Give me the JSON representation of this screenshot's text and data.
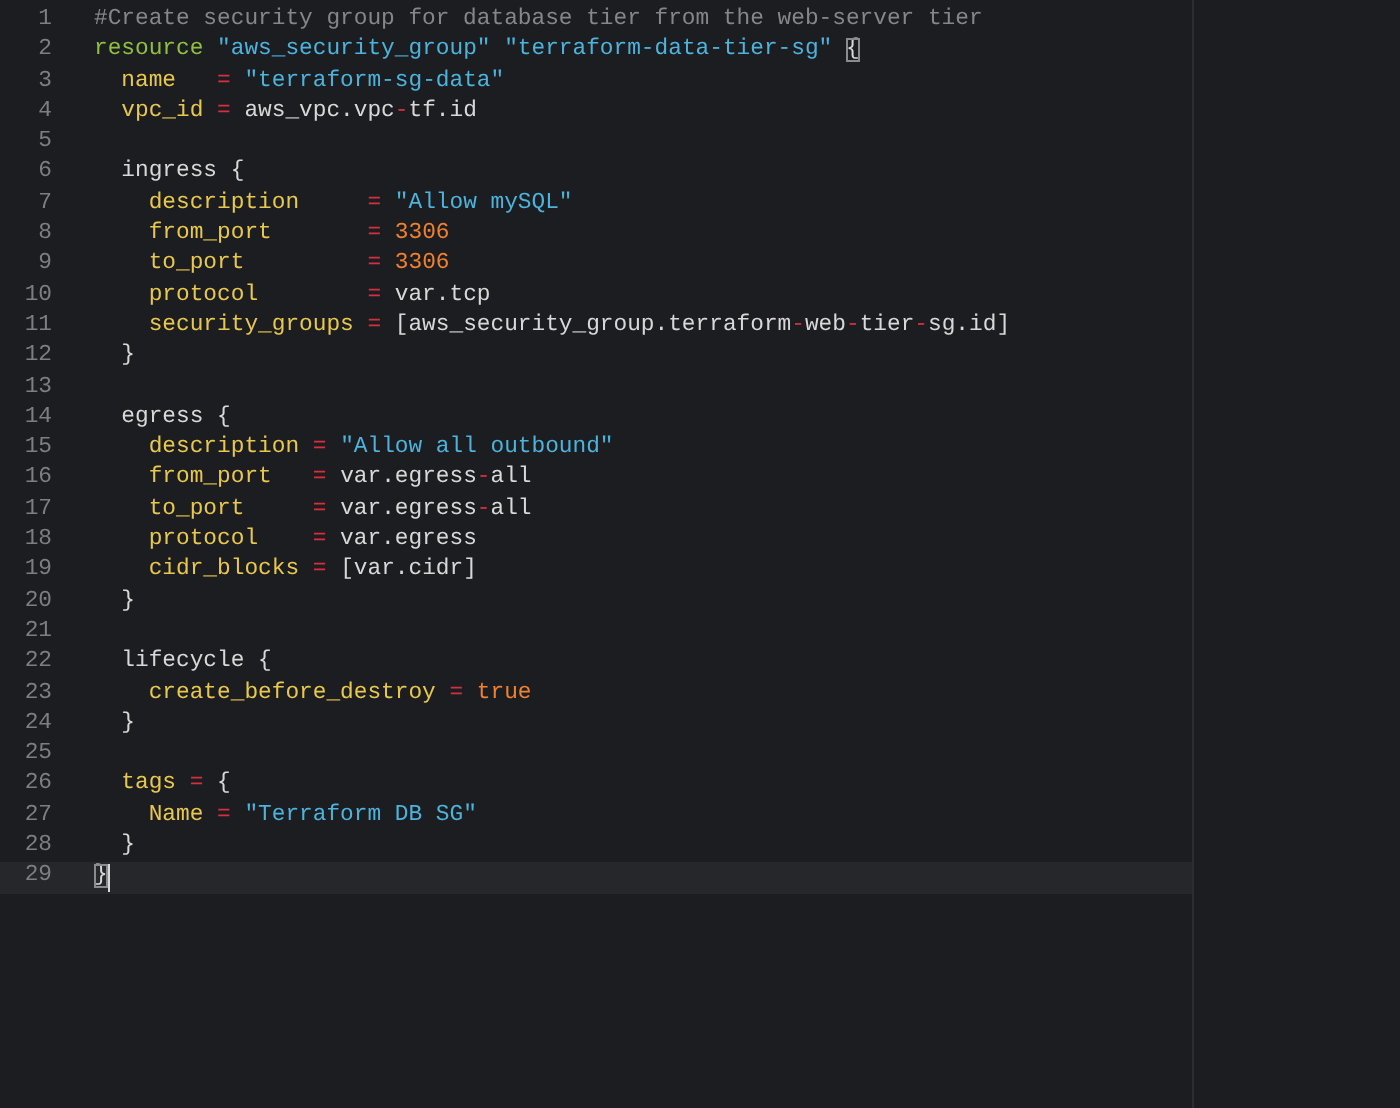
{
  "editor": {
    "lines": [
      {
        "number": "1",
        "current": false,
        "tokens": [
          {
            "kind": "comment",
            "text": "#Create security group for database tier from the web-server tier"
          }
        ]
      },
      {
        "number": "2",
        "current": false,
        "tokens": [
          {
            "kind": "keyword",
            "text": "resource "
          },
          {
            "kind": "string",
            "text": "\"aws_security_group\" "
          },
          {
            "kind": "string",
            "text": "\"terraform-data-tier-sg\" "
          },
          {
            "kind": "plain",
            "text": "{",
            "matched": true
          }
        ]
      },
      {
        "number": "3",
        "current": false,
        "tokens": [
          {
            "kind": "attribute",
            "text": "  name"
          },
          {
            "kind": "operator",
            "text": "   = "
          },
          {
            "kind": "string",
            "text": "\"terraform-sg-data\""
          }
        ]
      },
      {
        "number": "4",
        "current": false,
        "tokens": [
          {
            "kind": "attribute",
            "text": "  vpc_id"
          },
          {
            "kind": "operator",
            "text": " = "
          },
          {
            "kind": "plain",
            "text": "aws_vpc.vpc"
          },
          {
            "kind": "operator",
            "text": "-"
          },
          {
            "kind": "plain",
            "text": "tf.id"
          }
        ]
      },
      {
        "number": "5",
        "current": false
      },
      {
        "number": "6",
        "current": false,
        "tokens": [
          {
            "kind": "plain",
            "text": "  ingress {"
          }
        ]
      },
      {
        "number": "7",
        "current": false,
        "tokens": [
          {
            "kind": "attribute",
            "text": "    description"
          },
          {
            "kind": "operator",
            "text": "     = "
          },
          {
            "kind": "string",
            "text": "\"Allow mySQL\""
          }
        ]
      },
      {
        "number": "8",
        "current": false,
        "tokens": [
          {
            "kind": "attribute",
            "text": "    from_port"
          },
          {
            "kind": "operator",
            "text": "       = "
          },
          {
            "kind": "number",
            "text": "3306"
          }
        ]
      },
      {
        "number": "9",
        "current": false,
        "tokens": [
          {
            "kind": "attribute",
            "text": "    to_port"
          },
          {
            "kind": "operator",
            "text": "         = "
          },
          {
            "kind": "number",
            "text": "3306"
          }
        ]
      },
      {
        "number": "10",
        "current": false,
        "tokens": [
          {
            "kind": "attribute",
            "text": "    protocol"
          },
          {
            "kind": "operator",
            "text": "        = "
          },
          {
            "kind": "plain",
            "text": "var.tcp"
          }
        ]
      },
      {
        "number": "11",
        "current": false,
        "tokens": [
          {
            "kind": "attribute",
            "text": "    security_groups"
          },
          {
            "kind": "operator",
            "text": " = "
          },
          {
            "kind": "plain",
            "text": "[aws_security_group.terraform"
          },
          {
            "kind": "operator",
            "text": "-"
          },
          {
            "kind": "plain",
            "text": "web"
          },
          {
            "kind": "operator",
            "text": "-"
          },
          {
            "kind": "plain",
            "text": "tier"
          },
          {
            "kind": "operator",
            "text": "-"
          },
          {
            "kind": "plain",
            "text": "sg.id]"
          }
        ]
      },
      {
        "number": "12",
        "current": false,
        "tokens": [
          {
            "kind": "plain",
            "text": "  }"
          }
        ]
      },
      {
        "number": "13",
        "current": false
      },
      {
        "number": "14",
        "current": false,
        "tokens": [
          {
            "kind": "plain",
            "text": "  egress {"
          }
        ]
      },
      {
        "number": "15",
        "current": false,
        "tokens": [
          {
            "kind": "attribute",
            "text": "    description"
          },
          {
            "kind": "operator",
            "text": " = "
          },
          {
            "kind": "string",
            "text": "\"Allow all outbound\""
          }
        ]
      },
      {
        "number": "16",
        "current": false,
        "tokens": [
          {
            "kind": "attribute",
            "text": "    from_port"
          },
          {
            "kind": "operator",
            "text": "   = "
          },
          {
            "kind": "plain",
            "text": "var.egress"
          },
          {
            "kind": "operator",
            "text": "-"
          },
          {
            "kind": "plain",
            "text": "all"
          }
        ]
      },
      {
        "number": "17",
        "current": false,
        "tokens": [
          {
            "kind": "attribute",
            "text": "    to_port"
          },
          {
            "kind": "operator",
            "text": "     = "
          },
          {
            "kind": "plain",
            "text": "var.egress"
          },
          {
            "kind": "operator",
            "text": "-"
          },
          {
            "kind": "plain",
            "text": "all"
          }
        ]
      },
      {
        "number": "18",
        "current": false,
        "tokens": [
          {
            "kind": "attribute",
            "text": "    protocol"
          },
          {
            "kind": "operator",
            "text": "    = "
          },
          {
            "kind": "plain",
            "text": "var.egress"
          }
        ]
      },
      {
        "number": "19",
        "current": false,
        "tokens": [
          {
            "kind": "attribute",
            "text": "    cidr_blocks"
          },
          {
            "kind": "operator",
            "text": " = "
          },
          {
            "kind": "plain",
            "text": "[var.cidr]"
          }
        ]
      },
      {
        "number": "20",
        "current": false,
        "tokens": [
          {
            "kind": "plain",
            "text": "  }"
          }
        ]
      },
      {
        "number": "21",
        "current": false
      },
      {
        "number": "22",
        "current": false,
        "tokens": [
          {
            "kind": "plain",
            "text": "  lifecycle {"
          }
        ]
      },
      {
        "number": "23",
        "current": false,
        "tokens": [
          {
            "kind": "attribute",
            "text": "    create_before_destroy"
          },
          {
            "kind": "operator",
            "text": " = "
          },
          {
            "kind": "number",
            "text": "true"
          }
        ]
      },
      {
        "number": "24",
        "current": false,
        "tokens": [
          {
            "kind": "plain",
            "text": "  }"
          }
        ]
      },
      {
        "number": "25",
        "current": false
      },
      {
        "number": "26",
        "current": false,
        "tokens": [
          {
            "kind": "attribute",
            "text": "  tags"
          },
          {
            "kind": "operator",
            "text": " = "
          },
          {
            "kind": "plain",
            "text": "{"
          }
        ]
      },
      {
        "number": "27",
        "current": false,
        "tokens": [
          {
            "kind": "attribute",
            "text": "    Name"
          },
          {
            "kind": "operator",
            "text": " = "
          },
          {
            "kind": "string",
            "text": "\"Terraform DB SG\""
          }
        ]
      },
      {
        "number": "28",
        "current": false,
        "tokens": [
          {
            "kind": "plain",
            "text": "  }"
          }
        ]
      },
      {
        "number": "29",
        "current": true,
        "tokens": [
          {
            "kind": "plain",
            "text": "}",
            "matched": true
          }
        ]
      }
    ]
  }
}
